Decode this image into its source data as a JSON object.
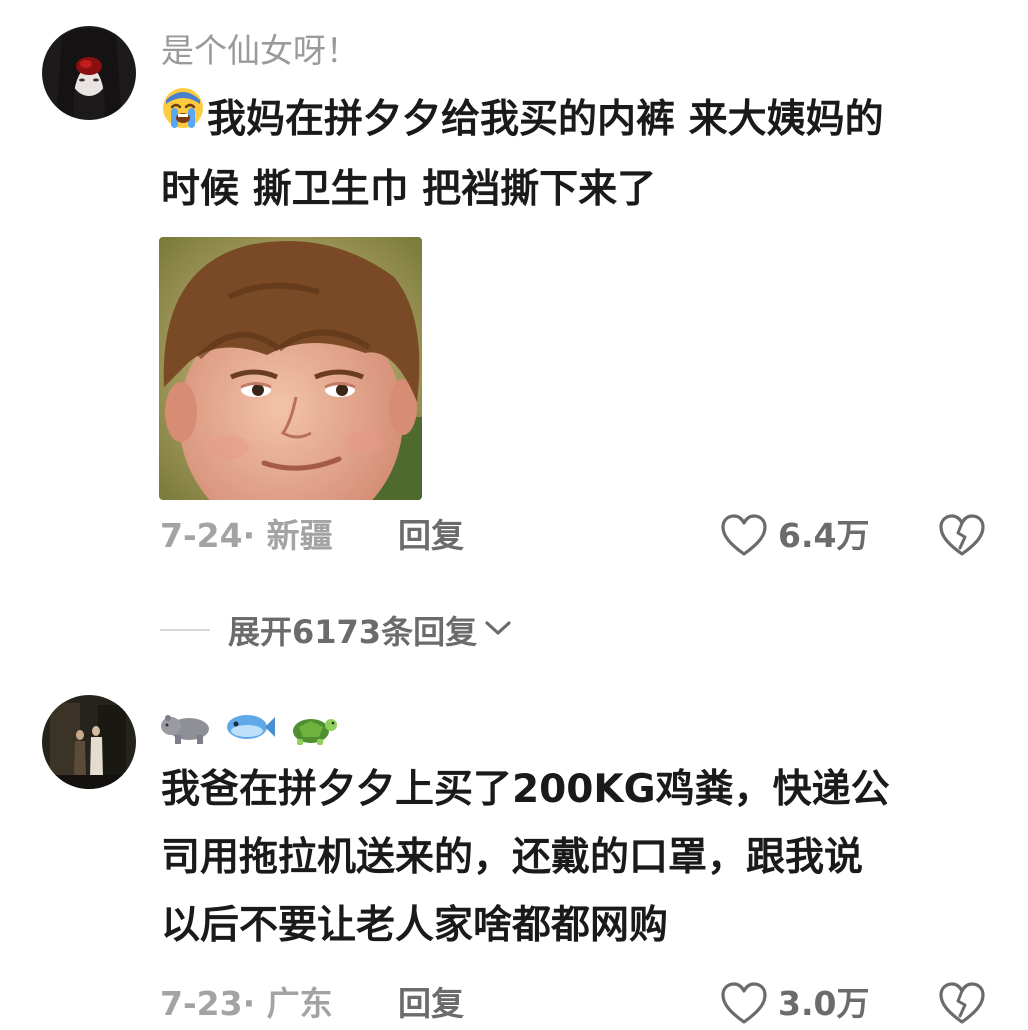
{
  "comments": [
    {
      "username": "是个仙女呀！",
      "emoji_prefix": "loudly-crying-face",
      "text_lines": [
        "我妈在拼夕夕给我买的内裤 来大姨妈的",
        "时候 撕卫生巾 把裆撕下来了"
      ],
      "image": "smirking-kid-meme",
      "date_location": "7-24· 新疆",
      "reply_label": "回复",
      "likes": "6.4万"
    },
    {
      "username_emojis": [
        "hippo",
        "fish",
        "turtle"
      ],
      "text_lines": [
        "我爸在拼夕夕上买了200KG鸡粪，快递公",
        "司用拖拉机送来的，还戴的口罩，跟我说",
        "以后不要让老人家啥都都网购"
      ],
      "date_location": "7-23· 广东",
      "reply_label": "回复",
      "likes": "3.0万"
    }
  ],
  "expand_replies": {
    "label": "展开6173条回复",
    "icon": "chevron-down-icon"
  },
  "colors": {
    "text": "#1a1a1a",
    "meta": "#a3a3a3",
    "secondary": "#6b6b6b",
    "background": "#ffffff"
  }
}
